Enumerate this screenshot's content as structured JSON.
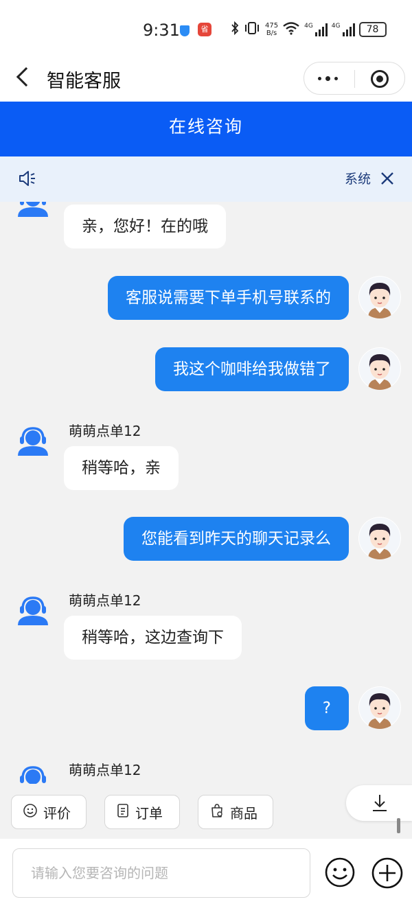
{
  "status_bar": {
    "time": "9:31",
    "app_badge": "省",
    "net_speed_value": "475",
    "net_speed_unit": "B/s",
    "network_1": "4G",
    "network_2": "4G",
    "battery": "78"
  },
  "title_bar": {
    "title": "智能客服"
  },
  "header": {
    "title": "在线咨询"
  },
  "notice": {
    "text": "系统"
  },
  "messages": [
    {
      "from": "agent",
      "name": "",
      "text": "亲，您好！在的哦"
    },
    {
      "from": "user",
      "text": "客服说需要下单手机号联系的"
    },
    {
      "from": "user",
      "text": "我这个咖啡给我做错了"
    },
    {
      "from": "agent",
      "name": "萌萌点单12",
      "text": "稍等哈，亲"
    },
    {
      "from": "user",
      "text": "您能看到昨天的聊天记录么"
    },
    {
      "from": "agent",
      "name": "萌萌点单12",
      "text": "稍等哈，这边查询下"
    },
    {
      "from": "user",
      "text": "?"
    },
    {
      "from": "agent",
      "name": "萌萌点单12",
      "text": ""
    }
  ],
  "quick_actions": [
    {
      "label": "评价",
      "icon": "smile-icon"
    },
    {
      "label": "订单",
      "icon": "document-icon"
    },
    {
      "label": "商品",
      "icon": "bag-icon"
    }
  ],
  "input": {
    "placeholder": "请输入您要咨询的问题",
    "value": ""
  },
  "colors": {
    "header_blue": "#0a5cf5",
    "user_bubble": "#1e82f0",
    "agent_avatar": "#2b7af5",
    "notice_bg": "#e9f1fb"
  }
}
